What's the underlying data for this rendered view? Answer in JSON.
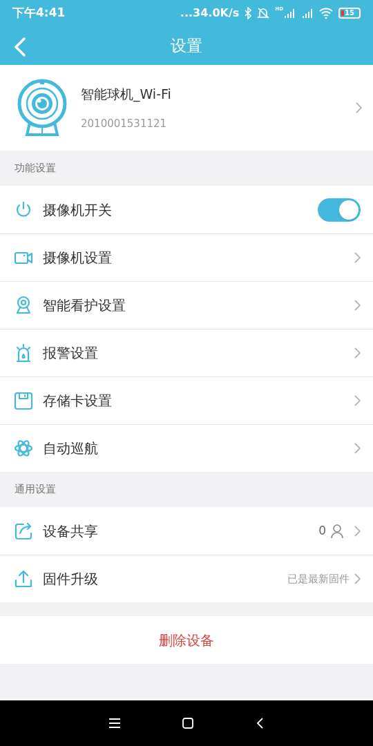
{
  "status_bar": {
    "time": "下午4:41",
    "speed": "...34.0K/s",
    "network_label": "HD",
    "battery": "15"
  },
  "header": {
    "title": "设置"
  },
  "device": {
    "name": "智能球机_Wi-Fi",
    "serial": "2010001531121"
  },
  "sections": [
    {
      "title": "功能设置",
      "rows": [
        {
          "kind": "toggle",
          "label": "摄像机开关",
          "on": true
        },
        {
          "kind": "link",
          "label": "摄像机设置"
        },
        {
          "kind": "link",
          "label": "智能看护设置"
        },
        {
          "kind": "link",
          "label": "报警设置"
        },
        {
          "kind": "link",
          "label": "存储卡设置"
        },
        {
          "kind": "link",
          "label": "自动巡航"
        }
      ]
    },
    {
      "title": "通用设置",
      "rows": [
        {
          "kind": "share",
          "label": "设备共享",
          "value": "0"
        },
        {
          "kind": "link",
          "label": "固件升级",
          "value": "已是最新固件"
        }
      ]
    }
  ],
  "delete_button": "删除设备"
}
